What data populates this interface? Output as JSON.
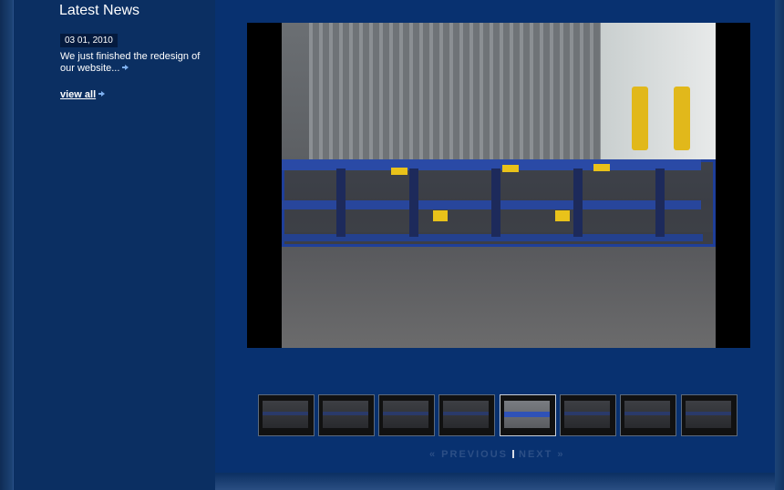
{
  "news": {
    "heading": "Latest News",
    "date": "03 01, 2010",
    "text": "We just finished the redesign of our website...",
    "view_all": "view all"
  },
  "gallery": {
    "thumbnails": 8,
    "active_index": 4,
    "prev_label": "« PREVIOUS",
    "next_label": "NEXT »"
  },
  "colors": {
    "background": "#163867",
    "sidebar": "#0b2f62",
    "main": "#083170",
    "link_arrow": "#7fb1f0",
    "pager_disabled": "#2c4f86"
  }
}
